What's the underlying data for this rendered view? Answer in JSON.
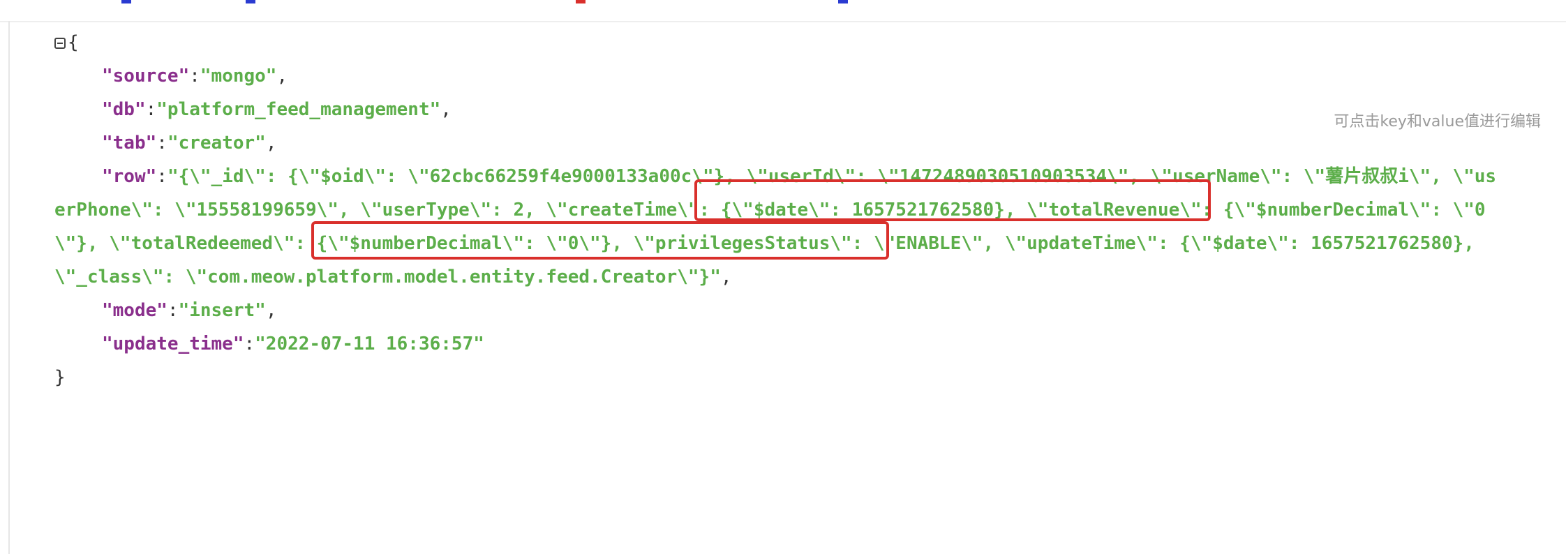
{
  "hint_text": "可点击key和value值进行编辑",
  "json": {
    "open_brace": "{",
    "close_brace": "}",
    "fields": [
      {
        "key": "\"source\"",
        "value": "\"mongo\""
      },
      {
        "key": "\"db\"",
        "value": "\"platform_feed_management\""
      },
      {
        "key": "\"tab\"",
        "value": "\"creator\""
      },
      {
        "key": "\"row\"",
        "value": "\"{\\\"_id\\\": {\\\"$oid\\\": \\\"62cbc66259f4e9000133a00c\\\"}, \\\"userId\\\": \\\"1472489030510903534\\\", \\\"userName\\\": \\\"薯片叔叔i\\\", \\\"userPhone\\\": \\\"15558199659\\\", \\\"userType\\\": 2, \\\"createTime\\\": {\\\"$date\\\": 1657521762580}, \\\"totalRevenue\\\": {\\\"$numberDecimal\\\": \\\"0\\\"}, \\\"totalRedeemed\\\": {\\\"$numberDecimal\\\": \\\"0\\\"}, \\\"privilegesStatus\\\": \\\"ENABLE\\\", \\\"updateTime\\\": {\\\"$date\\\": 1657521762580}, \\\"_class\\\": \\\"com.meow.platform.model.entity.feed.Creator\\\"}\""
      },
      {
        "key": "\"mode\"",
        "value": "\"insert\""
      },
      {
        "key": "\"update_time\"",
        "value": "\"2022-07-11 16:36:57\""
      }
    ]
  },
  "colors": {
    "key": "#8a2f8c",
    "string": "#5cae4a",
    "highlight": "#d9302c",
    "hint": "#9a9a9a"
  }
}
